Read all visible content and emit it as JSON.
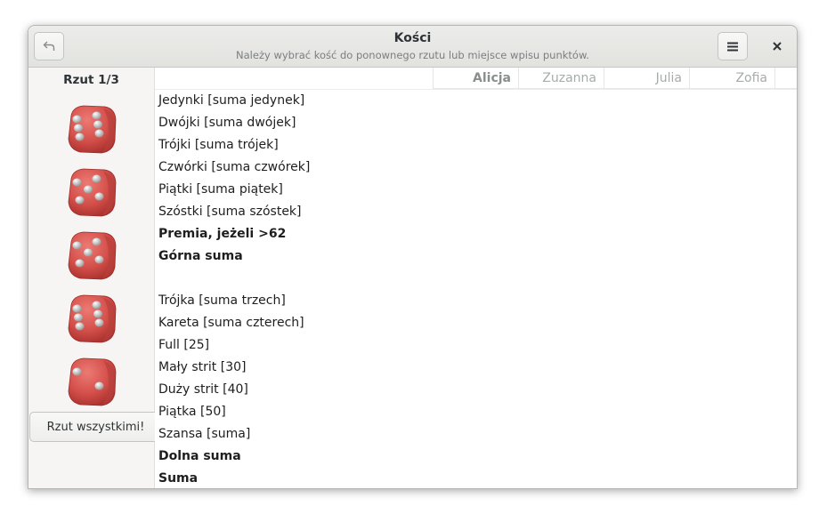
{
  "window": {
    "title": "Kości",
    "subtitle": "Należy wybrać kość do ponownego rzutu lub miejsce wpisu punktów."
  },
  "header_icons": {
    "undo": "undo-icon",
    "menu": "hamburger-menu-icon",
    "close": "close-icon"
  },
  "sidebar": {
    "roll_label": "Rzut 1/3",
    "dice": [
      6,
      5,
      5,
      6,
      2
    ],
    "roll_all_label": "Rzut wszystkimi!"
  },
  "players": [
    "Alicja",
    "Zuzanna",
    "Julia",
    "Zofia"
  ],
  "active_player": "Alicja",
  "categories": {
    "upper": [
      "Jedynki [suma jedynek]",
      "Dwójki [suma dwójek]",
      "Trójki [suma trójek]",
      "Czwórki [suma czwórek]",
      "Piątki [suma piątek]",
      "Szóstki [suma szóstek]"
    ],
    "bonus": "Premia, jeżeli >62",
    "upper_total": "Górna suma",
    "lower": [
      "Trójka [suma trzech]",
      "Kareta [suma czterech]",
      "Full [25]",
      "Mały strit [30]",
      "Duży strit [40]",
      "Piątka [50]",
      "Szansa [suma]"
    ],
    "lower_total": "Dolna suma",
    "grand_total": "Suma"
  },
  "colors": {
    "die": "#d9534f",
    "pip": "#e6e6e6"
  }
}
